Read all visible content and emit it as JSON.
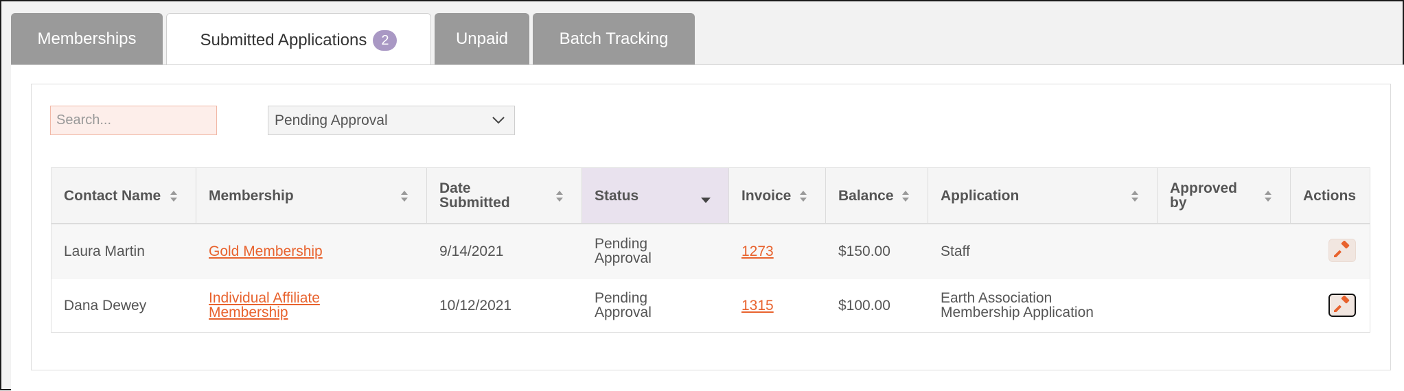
{
  "tabs": [
    {
      "label": "Memberships"
    },
    {
      "label": "Submitted Applications",
      "badge": "2"
    },
    {
      "label": "Unpaid"
    },
    {
      "label": "Batch Tracking"
    }
  ],
  "filters": {
    "search_placeholder": "Search...",
    "status_selected": "Pending Approval"
  },
  "table": {
    "columns": [
      {
        "label": "Contact Name"
      },
      {
        "label": "Membership"
      },
      {
        "label": "Date Submitted"
      },
      {
        "label": "Status"
      },
      {
        "label": "Invoice"
      },
      {
        "label": "Balance"
      },
      {
        "label": "Application"
      },
      {
        "label": "Approved by"
      },
      {
        "label": "Actions"
      }
    ],
    "rows": [
      {
        "contact": "Laura Martin",
        "membership": "Gold Membership",
        "date": "9/14/2021",
        "status": "Pending Approval",
        "invoice": "1273",
        "balance": "$150.00",
        "application": "Staff",
        "approved_by": ""
      },
      {
        "contact": "Dana Dewey",
        "membership": "Individual Affiliate Membership",
        "date": "10/12/2021",
        "status": "Pending Approval",
        "invoice": "1315",
        "balance": "$100.00",
        "application": "Earth Association Membership Application",
        "approved_by": ""
      }
    ]
  },
  "colors": {
    "accent": "#e8622d",
    "tab_inactive": "#9a9a9a",
    "badge": "#a998c4",
    "sorted_header": "#e9e2ee"
  },
  "icons": {
    "action": "gavel-icon",
    "sort": "sort-icon",
    "sort_desc": "caret-down-icon",
    "select": "chevron-down-icon"
  }
}
